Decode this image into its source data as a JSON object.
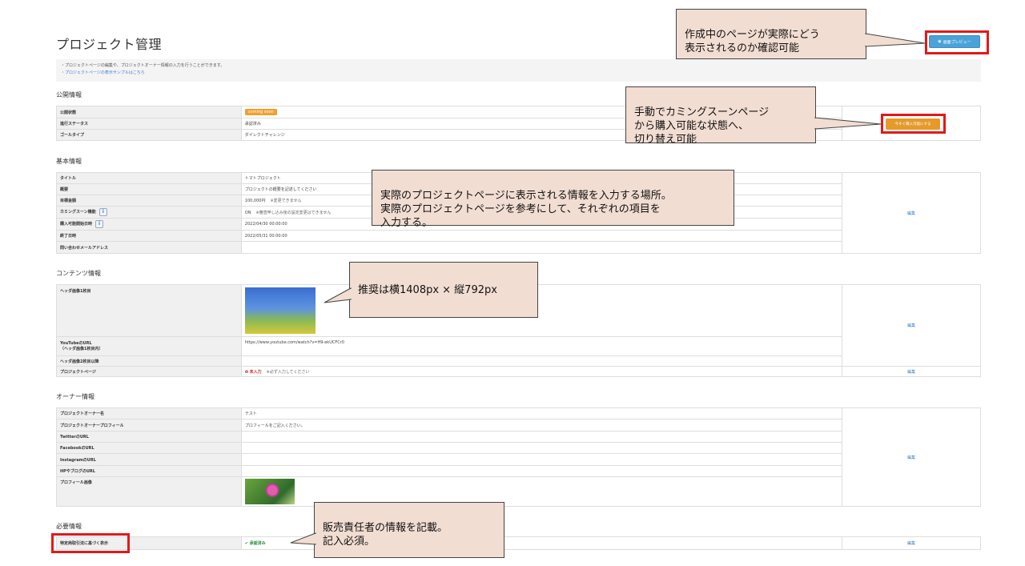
{
  "page": {
    "title": "プロジェクト管理",
    "preview_button": "画面プレビュー",
    "info_line1": "・プロジェクトページの編集や、プロジェクトオーナー情報の入力を行うことができます。",
    "info_line2": "・プロジェクトページの表示サンプルはこちら"
  },
  "public_info": {
    "title": "公開情報",
    "rows": [
      {
        "label": "公開状態",
        "value": "coming soon"
      },
      {
        "label": "進行ステータス",
        "value": "承認済み"
      },
      {
        "label": "ゴールタイプ",
        "value": "ダイレクトチャレンジ"
      }
    ],
    "action_button": "今すぐ購入可能にする"
  },
  "basic_info": {
    "title": "基本情報",
    "rows": [
      {
        "label": "タイトル",
        "value": "トマトプロジェクト",
        "note": ""
      },
      {
        "label": "概要",
        "value": "プロジェクトの概要を記述してください",
        "note": ""
      },
      {
        "label": "目標金額",
        "value": "100,000円",
        "note": "※変更できません"
      },
      {
        "label": "カミングスーン機能",
        "value": "ON",
        "note": "※審査申し込み後の設定変更はできません"
      },
      {
        "label": "購入可能開始日時",
        "value": "2022/04/30 00:00:00",
        "note": ""
      },
      {
        "label": "終了日時",
        "value": "2022/05/31 00:00:00",
        "note": ""
      },
      {
        "label": "問い合わせメールアドレス",
        "value": "",
        "note": ""
      }
    ],
    "edit": "編集"
  },
  "contents_info": {
    "title": "コンテンツ情報",
    "rows": [
      {
        "label": "ヘッダ画像1枚目",
        "value": ""
      },
      {
        "label": "YouTubeのURL\n（ヘッダ画像1枚目内）",
        "value": "https://www.youtube.com/watch?v=H9-ekUCFCr0"
      },
      {
        "label": "ヘッダ画像2枚目以降",
        "value": ""
      },
      {
        "label": "プロジェクトページ",
        "value": "未入力",
        "note": "※必ず入力してください"
      }
    ],
    "edit": "編集"
  },
  "owner_info": {
    "title": "オーナー情報",
    "rows": [
      {
        "label": "プロジェクトオーナー名",
        "value": "テスト"
      },
      {
        "label": "プロジェクトオーナープロフィール",
        "value": "プロフィールをご記入ください。"
      },
      {
        "label": "TwitterのURL",
        "value": ""
      },
      {
        "label": "FacebookのURL",
        "value": ""
      },
      {
        "label": "InstagramのURL",
        "value": ""
      },
      {
        "label": "HPやブログのURL",
        "value": ""
      },
      {
        "label": "プロフィール画像",
        "value": ""
      }
    ],
    "edit": "編集"
  },
  "required_info": {
    "title": "必要情報",
    "rows": [
      {
        "label": "特定商取引法に基づく表示",
        "value": "承認済み"
      }
    ],
    "edit": "編集"
  },
  "callouts": {
    "preview": "作成中のページが実際にどう\n表示されるのか確認可能",
    "coming_soon": "手動でカミングスーンページ\nから購入可能な状態へ、\n切り替え可能",
    "basic": "実際のプロジェクトページに表示される情報を入力する場所。\n実際のプロジェクトページを参考にして、それぞれの項目を\n入力する。",
    "image": "推奨は横1408px × 縦792px",
    "seller": "販売責任者の情報を記載。\n記入必須。"
  },
  "colors": {
    "accent_blue": "#4aa3d8",
    "orange": "#e59a2a",
    "callout_bg": "#f2ddd2",
    "highlight_red": "#e01a1a"
  }
}
